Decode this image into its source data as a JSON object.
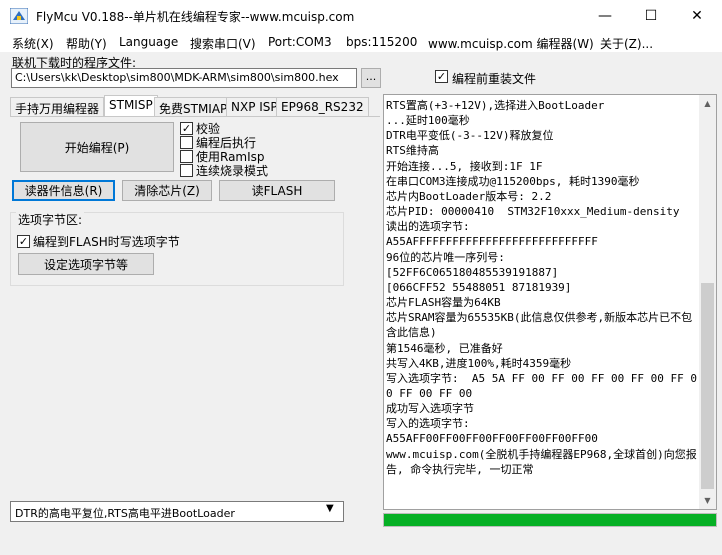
{
  "window": {
    "title": "FlyMcu V0.188--单片机在线编程专家--www.mcuisp.com",
    "minimize_glyph": "—",
    "maximize_glyph": "☐",
    "close_glyph": "✕",
    "app_icon": "flymcu-logo-icon"
  },
  "menu": {
    "items": [
      "系统(X)",
      "帮助(Y)",
      "Language",
      "搜索串口(V)",
      "Port:COM3",
      "bps:115200",
      "www.mcuisp.com 编程器(W)",
      "关于(Z)..."
    ]
  },
  "file": {
    "label": "联机下载时的程序文件:",
    "path": "C:\\Users\\kk\\Desktop\\sim800\\MDK-ARM\\sim800\\sim800.hex",
    "browse_label": "...",
    "reload_label": "编程前重装文件",
    "reload_checked": true
  },
  "tabs": [
    {
      "label": "手持万用编程器",
      "active": false
    },
    {
      "label": "STMISP",
      "active": true
    },
    {
      "label": "免费STMIAP",
      "active": false
    },
    {
      "label": "NXP ISP",
      "active": false
    },
    {
      "label": "EP968_RS232",
      "active": false
    }
  ],
  "stmisp": {
    "start_label": "开始编程(P)",
    "checks": [
      {
        "label": "校验",
        "checked": true
      },
      {
        "label": "编程后执行",
        "checked": false
      },
      {
        "label": "使用RamIsp",
        "checked": false
      },
      {
        "label": "连续烧录模式",
        "checked": false
      }
    ],
    "read_info_label": "读器件信息(R)",
    "clear_chip_label": "清除芯片(Z)",
    "read_flash_label": "读FLASH",
    "option_group_label": "选项字节区:",
    "option_check_label": "编程到FLASH时写选项字节",
    "option_checked": true,
    "set_option_label": "设定选项字节等",
    "check_glyph": "✓"
  },
  "dtr_select": {
    "value": "DTR的高电平复位,RTS高电平进BootLoader",
    "arrow_glyph": "▼"
  },
  "log": {
    "text": "RTS置高(+3-+12V),选择进入BootLoader\n...延时100毫秒\nDTR电平变低(-3--12V)释放复位\nRTS维持高\n开始连接...5, 接收到:1F 1F\n在串口COM3连接成功@115200bps, 耗时1390毫秒\n芯片内BootLoader版本号: 2.2\n芯片PID: 00000410  STM32F10xxx_Medium-density\n读出的选项字节:\nA55AFFFFFFFFFFFFFFFFFFFFFFFFFFFF\n96位的芯片唯一序列号:\n[52FF6C065180485539191887]\n[066CFF52 55488051 87181939]\n芯片FLASH容量为64KB\n芯片SRAM容量为65535KB(此信息仅供参考,新版本芯片已不包含此信息)\n第1546毫秒, 已准备好\n共写入4KB,进度100%,耗时4359毫秒\n写入选项字节:  A5 5A FF 00 FF 00 FF 00 FF 00 FF 00 FF 00 FF 00\n成功写入选项字节\n写入的选项字节:\nA55AFF00FF00FF00FF00FF00FF00FF00\nwww.mcuisp.com(全脱机手持编程器EP968,全球首创)向您报告, 命令执行完毕, 一切正常",
    "scroll_up_glyph": "▲",
    "scroll_down_glyph": "▼"
  },
  "progress": {
    "percent": 100,
    "color": "#06b025"
  }
}
